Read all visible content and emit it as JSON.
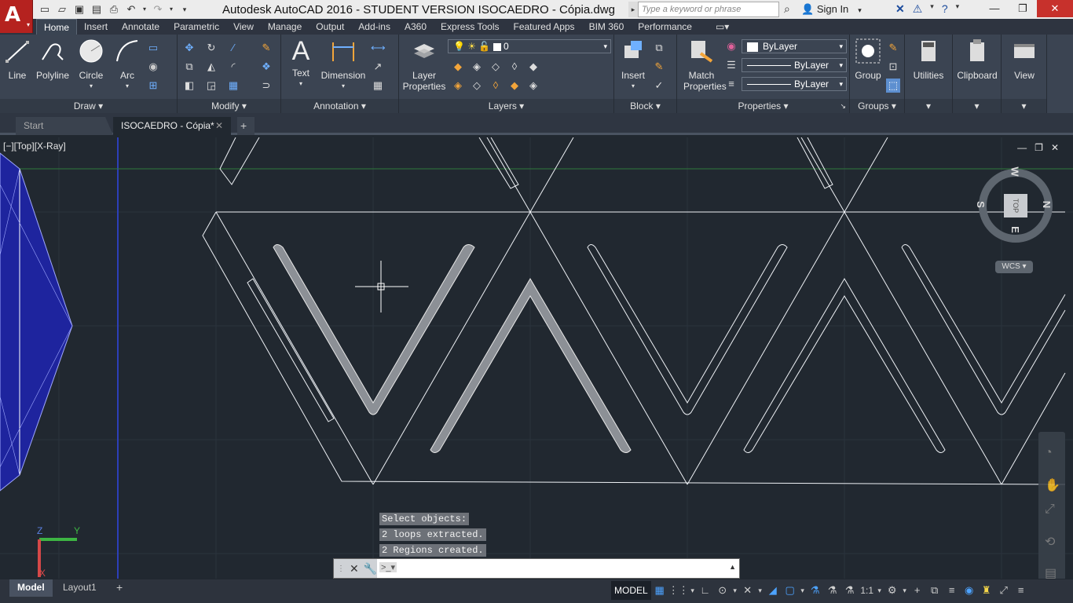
{
  "title": {
    "app_letter": "A",
    "text": "Autodesk AutoCAD 2016 - STUDENT VERSION    ISOCAEDRO - Cópia.dwg",
    "search_placeholder": "Type a keyword or phrase",
    "sign_in": "Sign In"
  },
  "ribbon_tabs": [
    "Home",
    "Insert",
    "Annotate",
    "Parametric",
    "View",
    "Manage",
    "Output",
    "Add-ins",
    "A360",
    "Express Tools",
    "Featured Apps",
    "BIM 360",
    "Performance"
  ],
  "draw": {
    "title": "Draw",
    "line": "Line",
    "polyline": "Polyline",
    "circle": "Circle",
    "arc": "Arc"
  },
  "modify": {
    "title": "Modify"
  },
  "annotation": {
    "title": "Annotation",
    "text": "Text",
    "dimension": "Dimension"
  },
  "layers": {
    "title": "Layers",
    "layer_properties_1": "Layer",
    "layer_properties_2": "Properties",
    "current_layer": "0"
  },
  "block": {
    "title": "Block",
    "insert": "Insert"
  },
  "properties": {
    "title": "Properties",
    "match_1": "Match",
    "match_2": "Properties",
    "color": "ByLayer",
    "linetype": "ByLayer",
    "lineweight": "ByLayer"
  },
  "groups": {
    "title": "Groups",
    "group": "Group"
  },
  "utilities": {
    "label": "Utilities"
  },
  "clipboard": {
    "label": "Clipboard"
  },
  "view": {
    "label": "View"
  },
  "doc_tabs": {
    "start": "Start",
    "current": "ISOCAEDRO - Cópia*"
  },
  "viewport": {
    "label": "[−][Top][X-Ray]",
    "viewcube_top": "TOP",
    "compass_n": "N",
    "compass_s": "S",
    "compass_e": "E",
    "compass_w": "W",
    "wcs": "WCS",
    "ucs_x": "X",
    "ucs_y": "Y",
    "ucs_z": "Z"
  },
  "command_history": [
    "Select objects:",
    "2 loops extracted.",
    "2 Regions created."
  ],
  "command": {
    "value": ""
  },
  "layout_tabs": [
    "Model",
    "Layout1"
  ],
  "status": {
    "model": "MODEL",
    "scale": "1:1"
  },
  "colors": {
    "accent": "#1e6fd9",
    "canvas": "#212830",
    "ribbon": "#3b4452",
    "app_red": "#b5221f"
  }
}
